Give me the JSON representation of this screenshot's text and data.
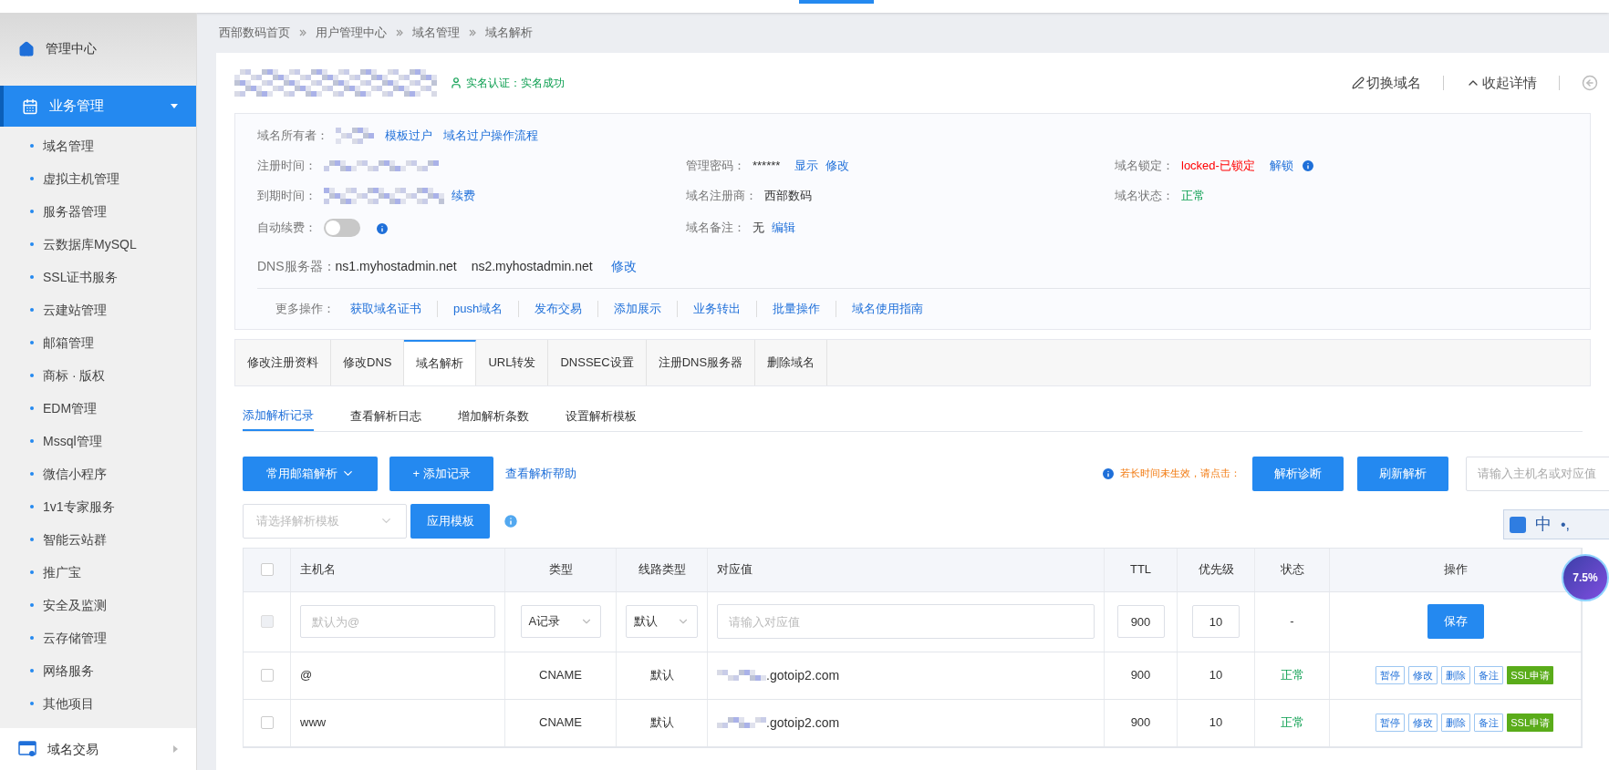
{
  "sidebar": {
    "header": "管理中心",
    "section": {
      "label": "业务管理",
      "expanded": true,
      "items": [
        "域名管理",
        "虚拟主机管理",
        "服务器管理",
        "云数据库MySQL",
        "SSL证书服务",
        "云建站管理",
        "邮箱管理",
        "商标 · 版权",
        "EDM管理",
        "Mssql管理",
        "微信小程序",
        "1v1专家服务",
        "智能云站群",
        "推广宝",
        "安全及监测",
        "云存储管理",
        "网络服务",
        "其他项目"
      ]
    },
    "footer_item": "域名交易"
  },
  "breadcrumb": [
    "西部数码首页",
    "用户管理中心",
    "域名管理",
    "域名解析"
  ],
  "domain_header": {
    "verification": "实名认证：实名成功",
    "actions": [
      "切换域名",
      "收起详情"
    ]
  },
  "info": {
    "owner": {
      "label": "域名所有者：",
      "links": [
        "模板过户",
        "域名过户操作流程"
      ]
    },
    "reg_time": {
      "label": "注册时间："
    },
    "expire": {
      "label": "到期时间：",
      "link": "续费"
    },
    "auto_renew": {
      "label": "自动续费：",
      "on": false
    },
    "password": {
      "label": "管理密码：",
      "value": "******",
      "links": [
        "显示",
        "修改"
      ]
    },
    "registrar": {
      "label": "域名注册商：",
      "value": "西部数码"
    },
    "remark": {
      "label": "域名备注：",
      "value": "无",
      "link": "编辑"
    },
    "lock": {
      "label": "域名锁定：",
      "value": "locked-已锁定",
      "link": "解锁"
    },
    "status": {
      "label": "域名状态：",
      "value": "正常"
    },
    "dns": {
      "label": "DNS服务器：",
      "servers": [
        "ns1.myhostadmin.net",
        "ns2.myhostadmin.net"
      ],
      "link": "修改"
    },
    "more_ops": {
      "label": "更多操作：",
      "links": [
        "获取域名证书",
        "push域名",
        "发布交易",
        "添加展示",
        "业务转出",
        "批量操作",
        "域名使用指南"
      ]
    }
  },
  "tabs": [
    {
      "label": "修改注册资料",
      "selected": false
    },
    {
      "label": "修改DNS",
      "selected": false
    },
    {
      "label": "域名解析",
      "selected": true
    },
    {
      "label": "URL转发",
      "selected": false
    },
    {
      "label": "DNSSEC设置",
      "selected": false
    },
    {
      "label": "注册DNS服务器",
      "selected": false
    },
    {
      "label": "删除域名",
      "selected": false
    }
  ],
  "subtabs": [
    {
      "label": "添加解析记录",
      "selected": true
    },
    {
      "label": "查看解析日志",
      "selected": false
    },
    {
      "label": "增加解析条数",
      "selected": false
    },
    {
      "label": "设置解析模板",
      "selected": false
    }
  ],
  "toolbar": {
    "mail": "常用邮箱解析",
    "add": "+ 添加记录",
    "help": "查看解析帮助",
    "notice": "若长时间未生效，请点击：",
    "diagnose": "解析诊断",
    "refresh": "刷新解析",
    "search_placeholder": "请输入主机名或对应值"
  },
  "template": {
    "placeholder": "请选择解析模板",
    "apply": "应用模板"
  },
  "table": {
    "header_checked": false,
    "columns": [
      "主机名",
      "类型",
      "线路类型",
      "对应值",
      "TTL",
      "优先级",
      "状态",
      "操作"
    ],
    "new_row": {
      "checked": false,
      "disabled": true,
      "host_placeholder": "默认为@",
      "type": "A记录",
      "line": "默认",
      "value_placeholder": "请输入对应值",
      "ttl": "900",
      "priority": "10",
      "status": "-",
      "save": "保存"
    },
    "rows": [
      {
        "checked": false,
        "host": "@",
        "type": "CNAME",
        "line": "默认",
        "value": ".gotoip2.com",
        "ttl": "900",
        "priority": "10",
        "status": "正常",
        "actions": [
          {
            "label": "暂停",
            "kind": "outline"
          },
          {
            "label": "修改",
            "kind": "outline"
          },
          {
            "label": "删除",
            "kind": "outline"
          },
          {
            "label": "备注",
            "kind": "outline"
          },
          {
            "label": "SSL申请",
            "kind": "ssl"
          }
        ]
      },
      {
        "checked": false,
        "host": "www",
        "type": "CNAME",
        "line": "默认",
        "value": ".gotoip2.com",
        "ttl": "900",
        "priority": "10",
        "status": "正常",
        "actions": [
          {
            "label": "暂停",
            "kind": "outline"
          },
          {
            "label": "修改",
            "kind": "outline"
          },
          {
            "label": "删除",
            "kind": "outline"
          },
          {
            "label": "备注",
            "kind": "outline"
          },
          {
            "label": "SSL申请",
            "kind": "ssl"
          }
        ]
      }
    ]
  },
  "ime_toolbar": {
    "mode": "中",
    "punctuation": "•,"
  },
  "floating_badge": "7.5%"
}
